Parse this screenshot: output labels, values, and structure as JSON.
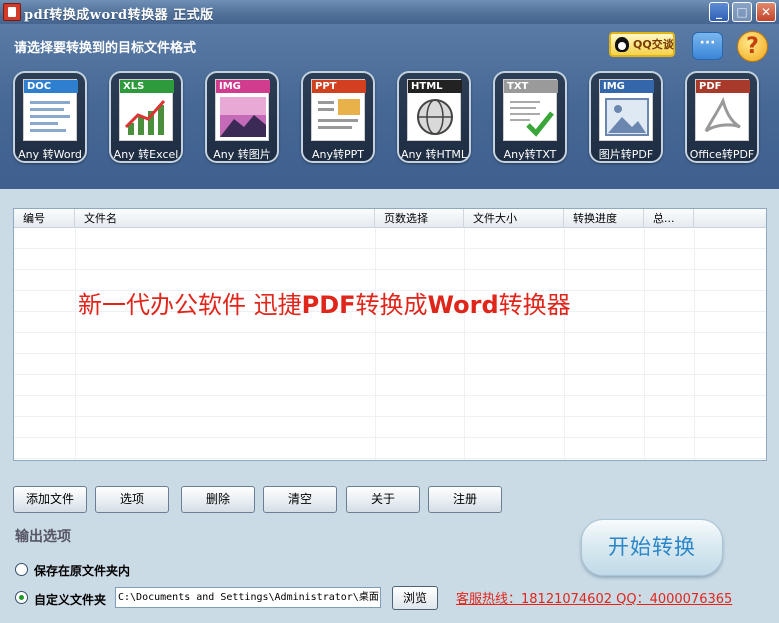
{
  "window": {
    "title": "pdf转换成word转换器 正式版",
    "controls": {
      "minimize": "_",
      "maximize": "□",
      "close": "✕"
    }
  },
  "header": {
    "prompt": "请选择要转换到的目标文件格式",
    "qq_label": "QQ交谈",
    "chat_glyph": "···",
    "help_glyph": "?",
    "formats": [
      {
        "badge": "DOC",
        "label": "Any 转Word",
        "band_color": "#2f7fd0"
      },
      {
        "badge": "XLS",
        "label": "Any 转Excel",
        "band_color": "#2d9a3c"
      },
      {
        "badge": "IMG",
        "label": "Any 转图片",
        "band_color": "#d13c8e"
      },
      {
        "badge": "PPT",
        "label": "Any转PPT",
        "band_color": "#d2401f"
      },
      {
        "badge": "HTML",
        "label": "Any 转HTML",
        "band_color": "#222222"
      },
      {
        "badge": "TXT",
        "label": "Any转TXT",
        "band_color": "#9a9a9a"
      },
      {
        "badge": "IMG",
        "label": "图片转PDF",
        "band_color": "#3366aa"
      },
      {
        "badge": "PDF",
        "label": "Office转PDF",
        "band_color": "#a83a2c"
      }
    ]
  },
  "file_list": {
    "columns": [
      "编号",
      "文件名",
      "页数选择",
      "文件大小",
      "转换进度",
      "总..."
    ],
    "rows": [],
    "watermark_plain": "新一代办公软件  迅捷",
    "watermark_bold1": "PDF",
    "watermark_mid": "转换成",
    "watermark_bold2": "Word",
    "watermark_end": "转换器"
  },
  "actions": {
    "add_file": "添加文件",
    "options": "选项",
    "delete": "删除",
    "clear": "清空",
    "about": "关于",
    "register": "注册"
  },
  "output": {
    "section_label": "输出选项",
    "save_original_label": "保存在原文件夹内",
    "custom_folder_label": "自定义文件夹",
    "custom_folder_selected": true,
    "path": "C:\\Documents and Settings\\Administrator\\桌面",
    "browse_label": "浏览"
  },
  "hotline": "客服热线：18121074602 QQ：4000076365",
  "start_button": "开始转换"
}
